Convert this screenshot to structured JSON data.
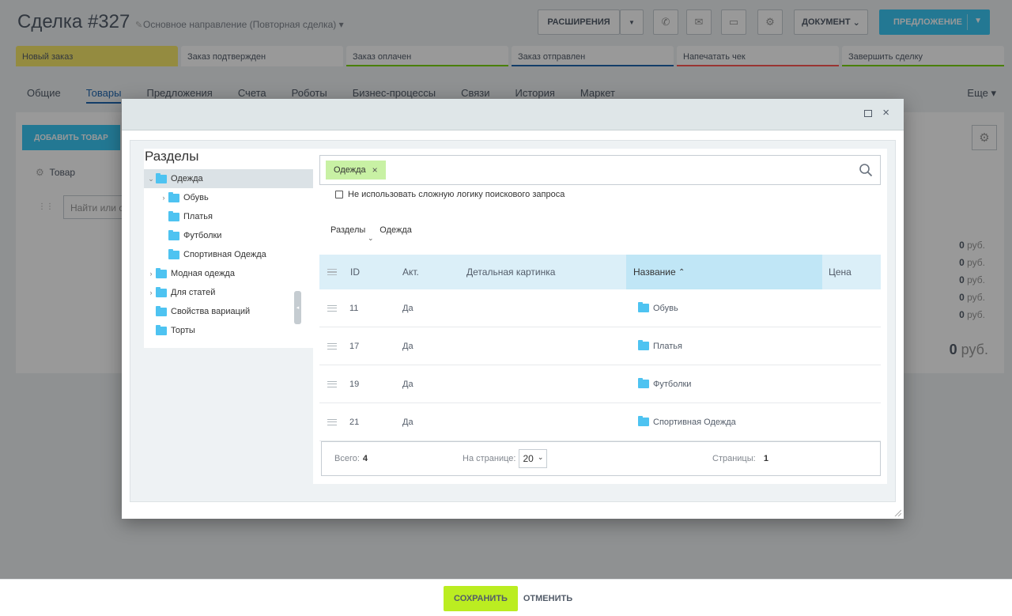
{
  "deal": {
    "title": "Сделка",
    "number": "#327",
    "direction": "Основное направление (Повторная сделка)"
  },
  "toolbar": {
    "extensions_label": "РАСШИРЕНИЯ",
    "document_label": "ДОКУМЕНТ",
    "offer_label": "ПРЕДЛОЖЕНИЕ"
  },
  "stages": [
    {
      "label": "Новый заказ",
      "color": "#f7e86c"
    },
    {
      "label": "Заказ подтвержден",
      "color": "#ffffff"
    },
    {
      "label": "Заказ оплачен",
      "color": "#7bd500"
    },
    {
      "label": "Заказ отправлен",
      "color": "#2067b0"
    },
    {
      "label": "Напечатать чек",
      "color": "#ff5752"
    },
    {
      "label": "Завершить сделку",
      "color": "#7bd500"
    }
  ],
  "tabs": [
    "Общие",
    "Товары",
    "Предложения",
    "Счета",
    "Роботы",
    "Бизнес-процессы",
    "Связи",
    "История",
    "Маркет"
  ],
  "more_tab": "Еще",
  "products": {
    "add_button": "ДОБАВИТЬ ТОВАР",
    "column_product": "Товар",
    "find_placeholder": "Найти или с",
    "sums": [
      "0",
      "0",
      "0",
      "0",
      "0"
    ],
    "currency": "руб.",
    "total": "0",
    "total_currency": "руб."
  },
  "dialog": {
    "sections_title": "Разделы",
    "tree": [
      {
        "label": "Одежда",
        "level": 0,
        "chevron": "⌄",
        "selected": true
      },
      {
        "label": "Обувь",
        "level": 1,
        "chevron": "›",
        "selected": false
      },
      {
        "label": "Платья",
        "level": 1,
        "chevron": "",
        "selected": false
      },
      {
        "label": "Футболки",
        "level": 1,
        "chevron": "",
        "selected": false
      },
      {
        "label": "Спортивная Одежда",
        "level": 1,
        "chevron": "",
        "selected": false
      },
      {
        "label": "Модная одежда",
        "level": 0,
        "chevron": "›",
        "selected": false
      },
      {
        "label": "Для статей",
        "level": 0,
        "chevron": "›",
        "selected": false
      },
      {
        "label": "Свойства вариаций",
        "level": 0,
        "chevron": "",
        "selected": false
      },
      {
        "label": "Торты",
        "level": 0,
        "chevron": "",
        "selected": false
      }
    ],
    "filter": {
      "tag": "Одежда",
      "checkbox_label": "Не использовать сложную логику поискового запроса"
    },
    "breadcrumbs": [
      "Разделы",
      "Одежда"
    ],
    "grid": {
      "columns": {
        "id": "ID",
        "active": "Акт.",
        "picture": "Детальная картинка",
        "name": "Название",
        "price": "Цена"
      },
      "sort_indicator": "⌃",
      "rows": [
        {
          "id": "11",
          "active": "Да",
          "name": "Обувь"
        },
        {
          "id": "17",
          "active": "Да",
          "name": "Платья"
        },
        {
          "id": "19",
          "active": "Да",
          "name": "Футболки"
        },
        {
          "id": "21",
          "active": "Да",
          "name": "Спортивная Одежда"
        }
      ]
    },
    "footer": {
      "total_label": "Всего:",
      "total_value": "4",
      "per_page_label": "На странице:",
      "per_page_value": "20",
      "pages_label": "Страницы:",
      "pages_value": "1"
    }
  },
  "page_footer": {
    "save_label": "СОХРАНИТЬ",
    "cancel_label": "ОТМЕНИТЬ"
  }
}
